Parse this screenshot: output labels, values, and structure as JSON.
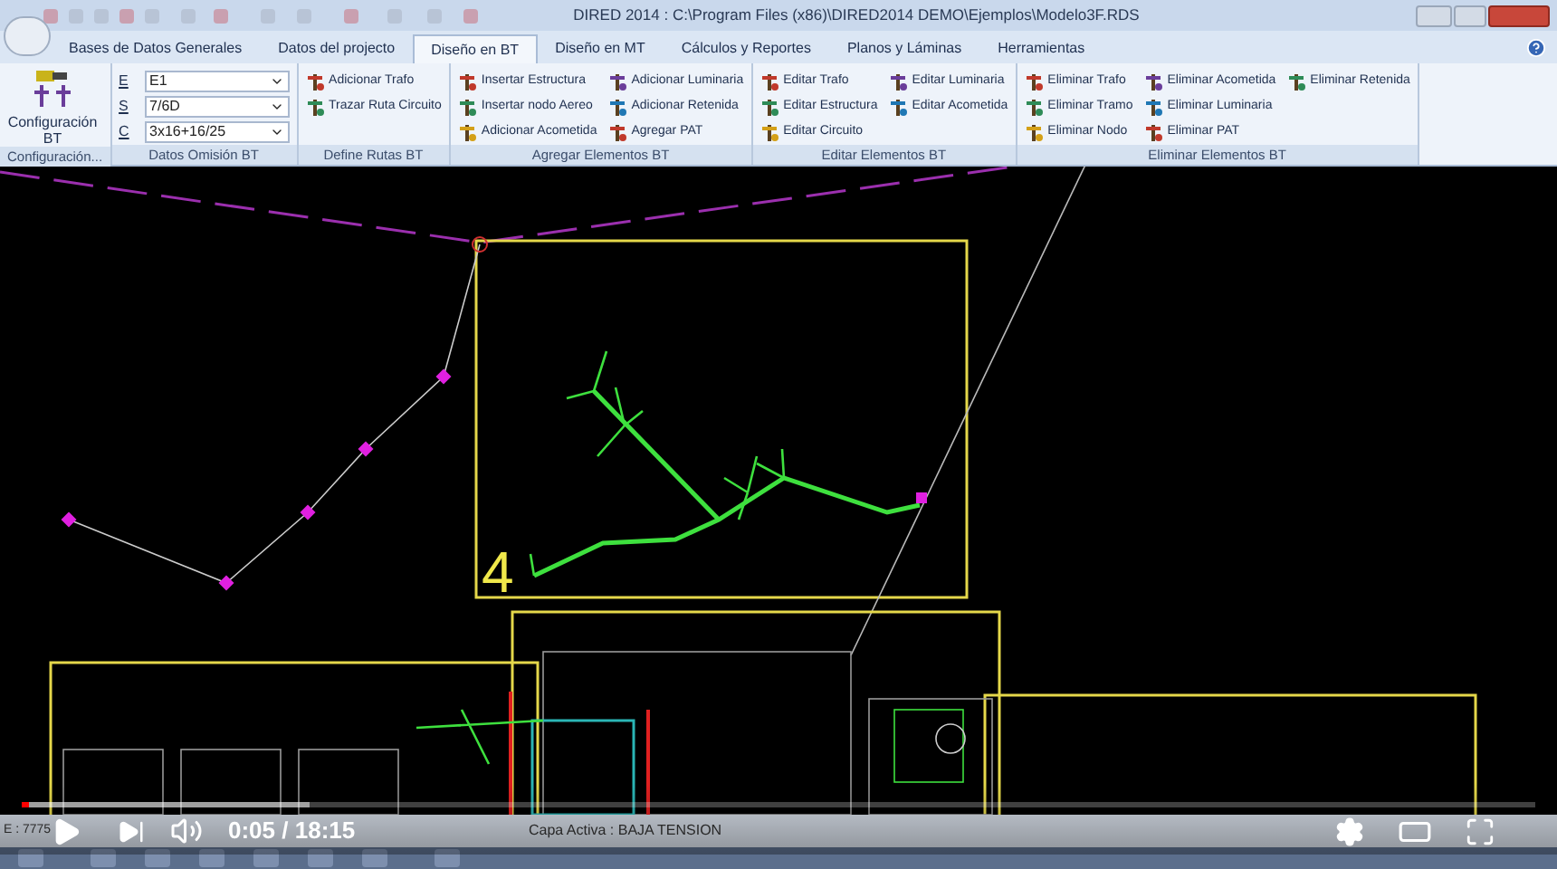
{
  "window": {
    "title": "DIRED 2014 : C:\\Program Files (x86)\\DIRED2014 DEMO\\Ejemplos\\Modelo3F.RDS"
  },
  "tabs": [
    {
      "label": "Bases de Datos Generales",
      "selected": false
    },
    {
      "label": "Datos del projecto",
      "selected": false
    },
    {
      "label": "Diseño en BT",
      "selected": true
    },
    {
      "label": "Diseño en MT",
      "selected": false
    },
    {
      "label": "Cálculos y Reportes",
      "selected": false
    },
    {
      "label": "Planos y Láminas",
      "selected": false
    },
    {
      "label": "Herramientas",
      "selected": false
    }
  ],
  "ribbon_groups": [
    {
      "label": "Configuración...",
      "kind": "large",
      "items": [
        {
          "label": "Configuración BT"
        }
      ]
    },
    {
      "label": "Datos Omisión BT",
      "kind": "combos",
      "items": [
        {
          "label": "E",
          "value": "E1"
        },
        {
          "label": "S",
          "value": "7/6D"
        },
        {
          "label": "C",
          "value": "3x16+16/25"
        }
      ]
    },
    {
      "label": "Define Rutas BT",
      "kind": "buttons",
      "items": [
        {
          "label": "Adicionar Trafo"
        },
        {
          "label": "Trazar Ruta Circuito"
        }
      ]
    },
    {
      "label": "Agregar Elementos BT",
      "kind": "buttons",
      "items": [
        {
          "label": "Insertar Estructura"
        },
        {
          "label": "Insertar nodo Aereo"
        },
        {
          "label": "Adicionar Acometida"
        },
        {
          "label": "Adicionar Luminaria"
        },
        {
          "label": "Adicionar Retenida"
        },
        {
          "label": "Agregar PAT"
        }
      ]
    },
    {
      "label": "Editar Elementos BT",
      "kind": "buttons",
      "items": [
        {
          "label": "Editar Trafo"
        },
        {
          "label": "Editar Estructura"
        },
        {
          "label": "Editar Circuito"
        },
        {
          "label": "Editar Luminaria"
        },
        {
          "label": "Editar Acometida"
        }
      ]
    },
    {
      "label": "Eliminar Elementos BT",
      "kind": "buttons",
      "items": [
        {
          "label": "Eliminar Trafo"
        },
        {
          "label": "Eliminar Tramo"
        },
        {
          "label": "Eliminar Nodo"
        },
        {
          "label": "Eliminar Acometida"
        },
        {
          "label": "Eliminar Luminaria"
        },
        {
          "label": "Eliminar PAT"
        },
        {
          "label": "Eliminar Retenida"
        }
      ]
    }
  ],
  "canvas": {
    "sector_label": "4"
  },
  "status_bar": {
    "coordinate": "E : 7775",
    "layer": "Capa Activa : BAJA TENSION"
  },
  "player": {
    "progress": {
      "level": 0.005
    },
    "buffer": {
      "level": 0.19
    },
    "time": "0:05 / 18:15"
  }
}
